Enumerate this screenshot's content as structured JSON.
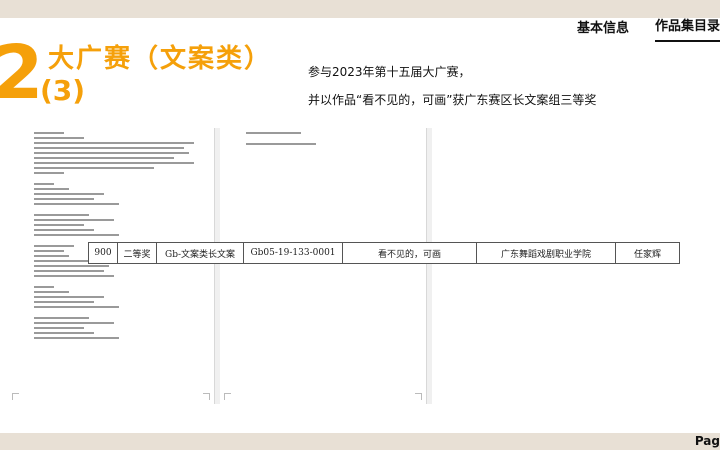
{
  "nav": {
    "items": [
      {
        "label": "基本信息"
      },
      {
        "label": "作品集目录"
      }
    ]
  },
  "section": {
    "number": "2",
    "subnumber": "(3)",
    "title": "大广赛（文案类）"
  },
  "description": {
    "line1": "参与2023年第十五届大广赛，",
    "line2": "并以作品“看不见的，可画”获广东赛区长文案组三等奖"
  },
  "award_row": {
    "cells": [
      "900",
      "二等奖",
      "Gb-文案类长文案",
      "Gb05-19-133-0001",
      "看不见的，可画",
      "广东舞蹈戏剧职业学院",
      "任家辉"
    ]
  },
  "footer": {
    "page_label": "Pag"
  }
}
